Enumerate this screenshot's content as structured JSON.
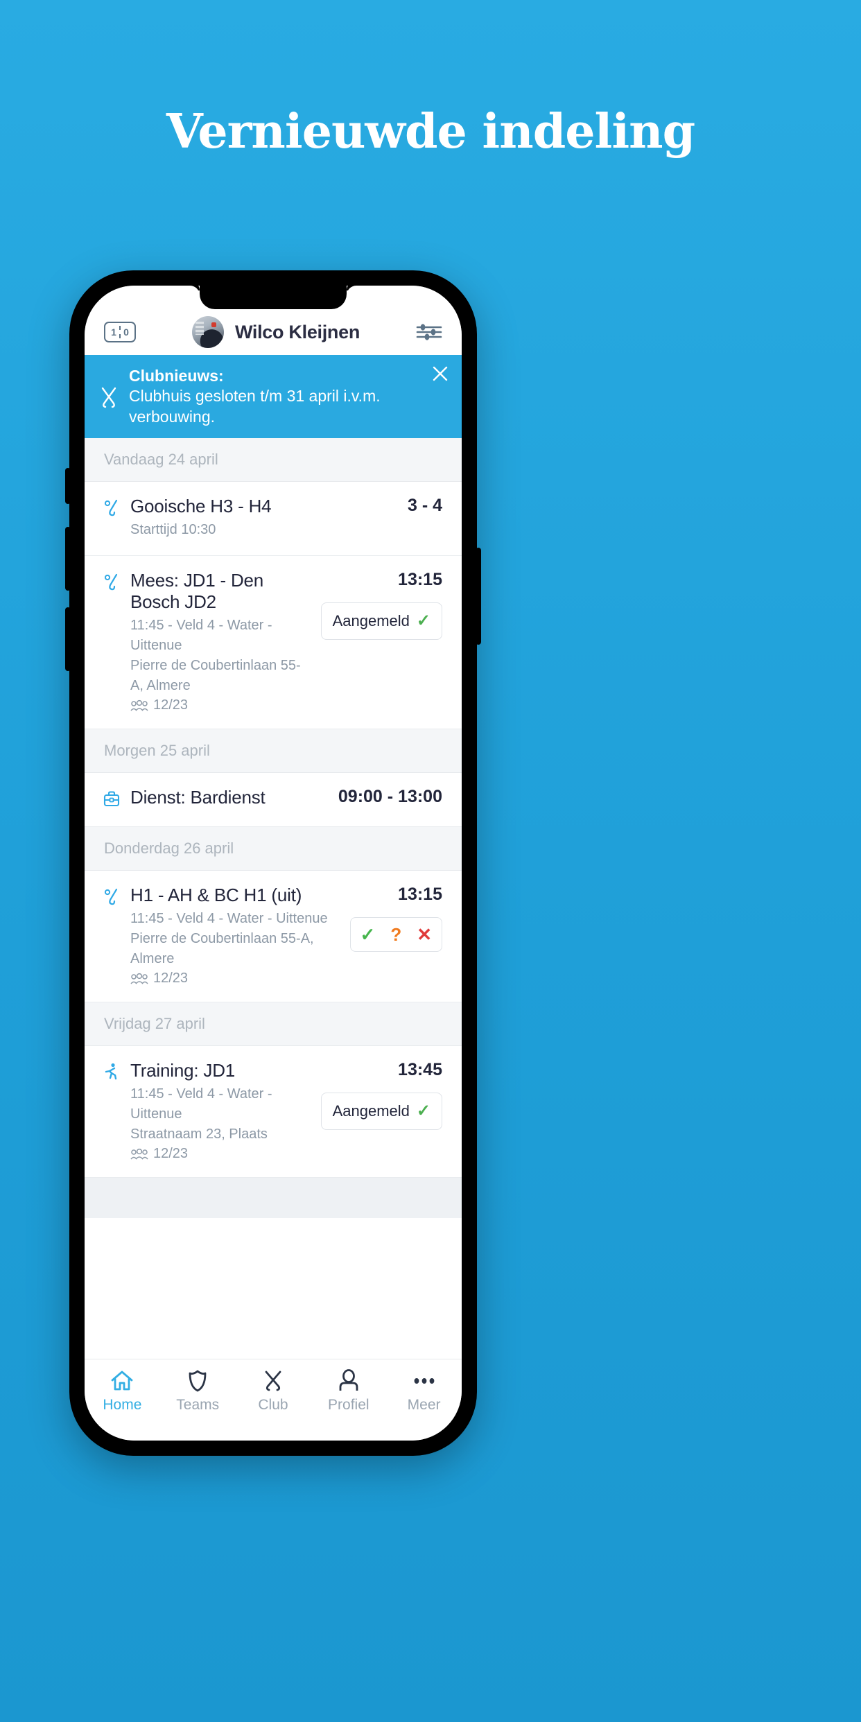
{
  "poster": {
    "headline": "Vernieuwde indeling",
    "background_color": "#29abe2"
  },
  "app": {
    "header": {
      "score_icon": {
        "name": "scoreboard-icon",
        "home": "1",
        "away": "0"
      },
      "avatar": "user-avatar",
      "user_name": "Wilco Kleijnen",
      "settings_icon": "sliders-icon"
    },
    "banner": {
      "icon": "hockey-sticks-icon",
      "title": "Clubnieuws:",
      "body": "Clubhuis gesloten t/m 31 april i.v.m. verbouwing.",
      "close_icon": "close-icon",
      "color": "#2aa9e0"
    },
    "sections": [
      {
        "day_label": "Vandaag 24 april",
        "events": [
          {
            "icon": "hockey-stick-ball-icon",
            "title": "Gooische H3 - H4",
            "lines": [
              "Starttijd 10:30"
            ],
            "attendance": null,
            "time": "3 - 4",
            "action": null
          }
        ]
      },
      {
        "day_label": "",
        "events": [
          {
            "icon": "hockey-stick-ball-icon",
            "title": "Mees: JD1 - Den Bosch JD2",
            "lines": [
              "11:45 - Veld 4 - Water - Uittenue",
              "Pierre de Coubertinlaan 55-A, Almere"
            ],
            "attendance": "12/23",
            "time": "13:15",
            "action": {
              "type": "status",
              "label": "Aangemeld",
              "check": "✓"
            }
          }
        ]
      },
      {
        "day_label": "Morgen 25 april",
        "events": [
          {
            "icon": "briefcase-icon",
            "title": "Dienst: Bardienst",
            "lines": [],
            "attendance": null,
            "time": "09:00 - 13:00",
            "action": null
          }
        ]
      },
      {
        "day_label": "Donderdag 26 april",
        "events": [
          {
            "icon": "hockey-stick-ball-icon",
            "title": "H1 - AH & BC H1 (uit)",
            "lines": [
              "11:45 - Veld 4 - Water - Uittenue",
              "Pierre de Coubertinlaan 55-A, Almere"
            ],
            "attendance": "12/23",
            "time": "13:15",
            "action": {
              "type": "choices",
              "yes": "✓",
              "maybe": "?",
              "no": "✕"
            }
          }
        ]
      },
      {
        "day_label": "Vrijdag 27 april",
        "events": [
          {
            "icon": "running-person-icon",
            "title": "Training: JD1",
            "lines": [
              "11:45 - Veld 4 - Water - Uittenue",
              "Straatnaam 23, Plaats"
            ],
            "attendance": "12/23",
            "time": "13:45",
            "action": {
              "type": "status",
              "label": "Aangemeld",
              "check": "✓"
            }
          }
        ]
      }
    ],
    "bottom_nav": {
      "active_color": "#33aee3",
      "items": [
        {
          "icon": "home-icon",
          "label": "Home",
          "active": true
        },
        {
          "icon": "shield-icon",
          "label": "Teams",
          "active": false
        },
        {
          "icon": "crossed-sticks-icon",
          "label": "Club",
          "active": false
        },
        {
          "icon": "person-icon",
          "label": "Profiel",
          "active": false
        },
        {
          "icon": "ellipsis-icon",
          "label": "Meer",
          "active": false
        }
      ]
    }
  }
}
